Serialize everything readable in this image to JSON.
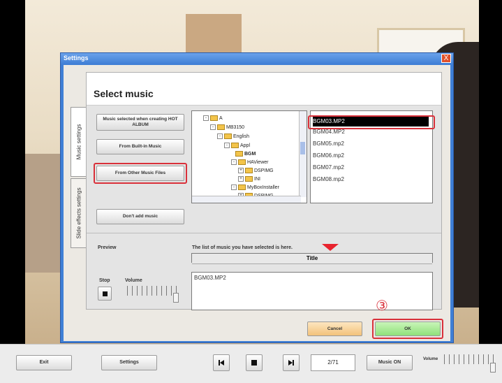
{
  "dialog": {
    "title": "Settings",
    "close_glyph": "X"
  },
  "tabs": {
    "music": "Music settings",
    "slide": "Slide effects settings"
  },
  "select_music": {
    "heading": "Select music",
    "btn_hot_album": "Music selected when creating HOT ALBUM",
    "btn_builtin": "From Built-in Music",
    "btn_other": "From Other Music Files",
    "btn_dont_add": "Don't add music"
  },
  "tree": {
    "items": [
      "A",
      "MB3150",
      "English",
      "Appl",
      "BGM",
      "HAViewer",
      "DSPIMG",
      "INI",
      "MyBoxInstaller",
      "DSPIMG"
    ]
  },
  "files": [
    "BGM03.MP2",
    "BGM04.MP2",
    "BGM05.mp2",
    "BGM06.mp2",
    "BGM07.mp2",
    "BGM08.mp2"
  ],
  "preview": {
    "label": "Preview",
    "stop": "Stop",
    "volume": "Volume"
  },
  "selected": {
    "note": "The list of music you have selected is here.",
    "header": "Title",
    "rows": [
      "BGM03.MP2"
    ]
  },
  "actions": {
    "cancel": "Cancel",
    "ok": "OK",
    "step_marker": "③"
  },
  "bottombar": {
    "exit": "Exit",
    "settings": "Settings",
    "page": "2/71",
    "music_on": "Music ON",
    "volume": "Volume"
  },
  "colors": {
    "highlight": "#d9303a",
    "ok_green": "#8fe07a",
    "cancel_orange": "#f3c27a",
    "title_blue": "#3f7fd6"
  }
}
